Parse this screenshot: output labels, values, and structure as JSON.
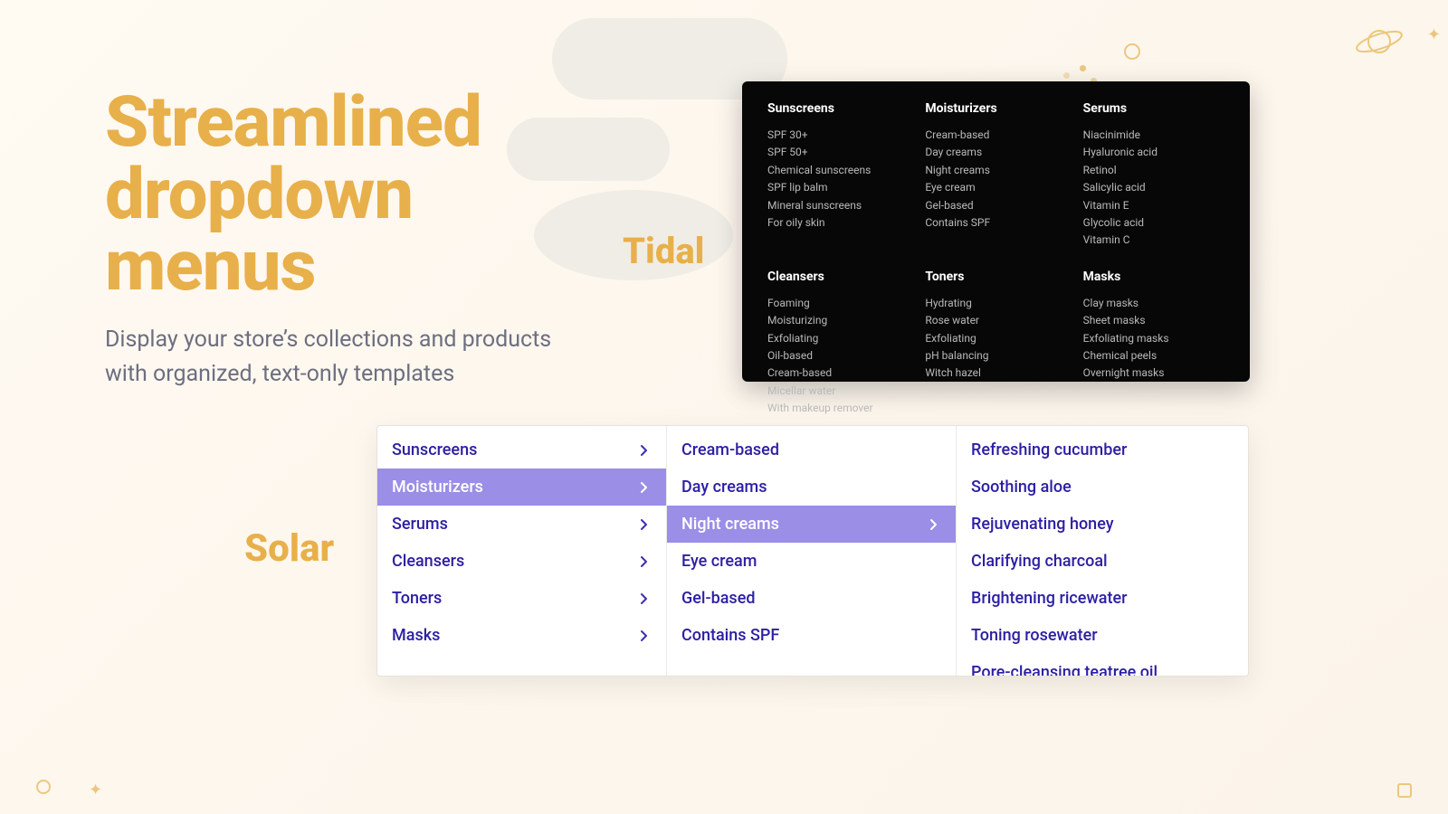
{
  "hero": {
    "title_l1": "Streamlined",
    "title_l2": "dropdown",
    "title_l3": "menus",
    "subtitle": "Display your store’s collections and products with organized, text-only templates"
  },
  "templates": {
    "tidal_label": "Tidal",
    "solar_label": "Solar"
  },
  "tidal": {
    "row1": [
      {
        "heading": "Sunscreens",
        "items": [
          "SPF 30+",
          "SPF 50+",
          "Chemical sunscreens",
          "SPF lip balm",
          "Mineral sunscreens",
          "For oily skin"
        ]
      },
      {
        "heading": "Moisturizers",
        "items": [
          "Cream-based",
          "Day creams",
          "Night creams",
          "Eye cream",
          "Gel-based",
          "Contains SPF"
        ]
      },
      {
        "heading": "Serums",
        "items": [
          "Niacinimide",
          "Hyaluronic acid",
          "Retinol",
          "Salicylic acid",
          "Vitamin E",
          "Glycolic acid",
          "Vitamin C"
        ]
      }
    ],
    "row2": [
      {
        "heading": "Cleansers",
        "items": [
          "Foaming",
          "Moisturizing",
          "Exfoliating",
          "Oil-based",
          "Cream-based",
          "Micellar water",
          "With makeup remover"
        ]
      },
      {
        "heading": "Toners",
        "items": [
          "Hydrating",
          "Rose water",
          "Exfoliating",
          "pH balancing",
          "Witch hazel"
        ]
      },
      {
        "heading": "Masks",
        "items": [
          "Clay masks",
          "Sheet masks",
          "Exfoliating masks",
          "Chemical peels",
          "Overnight masks"
        ]
      }
    ]
  },
  "solar": {
    "col1": {
      "selected_index": 1,
      "items": [
        "Sunscreens",
        "Moisturizers",
        "Serums",
        "Cleansers",
        "Toners",
        "Masks"
      ]
    },
    "col2": {
      "selected_index": 2,
      "items": [
        "Cream-based",
        "Day creams",
        "Night creams",
        "Eye cream",
        "Gel-based",
        "Contains SPF"
      ]
    },
    "col3": {
      "items": [
        "Refreshing cucumber",
        "Soothing aloe",
        "Rejuvenating honey",
        "Clarifying charcoal",
        "Brightening ricewater",
        "Toning rosewater",
        "Pore-cleansing teatree oil"
      ]
    }
  }
}
